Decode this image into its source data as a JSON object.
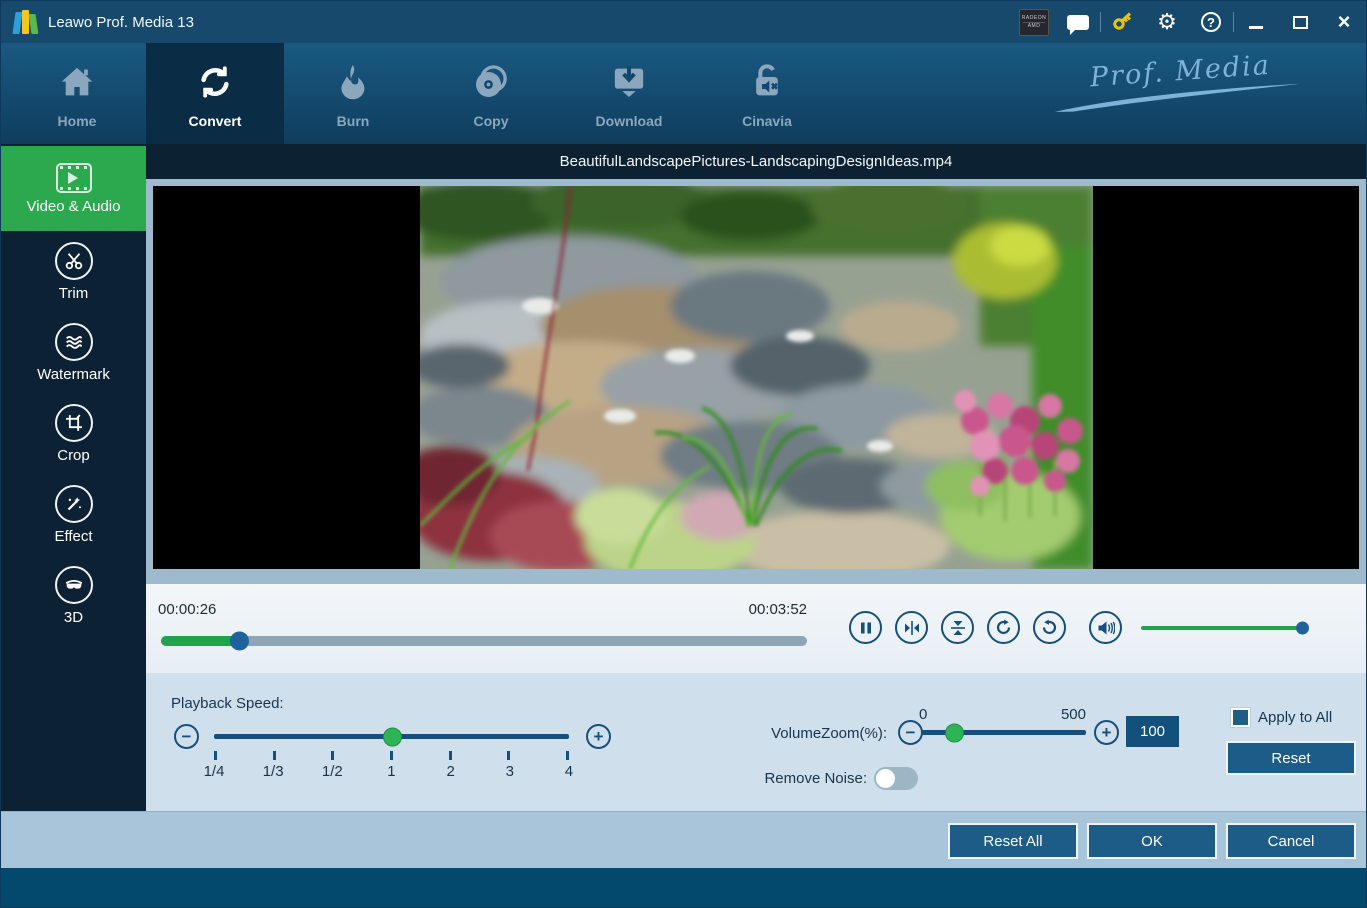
{
  "titlebar": {
    "title": "Leawo Prof. Media 13",
    "amd_badge_line1": "RADEON",
    "amd_badge_line2": "AMD",
    "gear_glyph": "⚙",
    "help_glyph": "?",
    "close_glyph": "×"
  },
  "nav": {
    "items": [
      {
        "label": "Home"
      },
      {
        "label": "Convert"
      },
      {
        "label": "Burn"
      },
      {
        "label": "Copy"
      },
      {
        "label": "Download"
      },
      {
        "label": "Cinavia"
      }
    ],
    "brand": "Prof. Media"
  },
  "sidebar": {
    "items": [
      {
        "label": "Video & Audio"
      },
      {
        "label": "Trim"
      },
      {
        "label": "Watermark"
      },
      {
        "label": "Crop"
      },
      {
        "label": "Effect"
      },
      {
        "label": "3D"
      }
    ]
  },
  "player": {
    "filename": "BeautifulLandscapePictures-LandscapingDesignIdeas.mp4",
    "current_time": "00:00:26",
    "total_time": "00:03:52",
    "progress_pct": 12,
    "volume_pct": 100
  },
  "settings": {
    "playback_speed": {
      "label": "Playback Speed:",
      "ticks": [
        "1/4",
        "1/3",
        "1/2",
        "1",
        "2",
        "3",
        "4"
      ],
      "value": "1",
      "thumb_pct": 50,
      "minus_glyph": "−",
      "plus_glyph": "+"
    },
    "volume_zoom": {
      "label": "VolumeZoom(%):",
      "min": "0",
      "max": "500",
      "value": "100",
      "thumb_pct": 20,
      "minus_glyph": "−",
      "plus_glyph": "+"
    },
    "remove_noise": {
      "label": "Remove Noise:",
      "enabled": false
    },
    "apply_to_all_label": "Apply to All",
    "reset_label": "Reset"
  },
  "footer": {
    "reset_all_label": "Reset All",
    "ok_label": "OK",
    "cancel_label": "Cancel"
  },
  "colors": {
    "accent_green": "#2ca94e",
    "progress_green": "#21a24b",
    "control_blue": "#174f7b",
    "button_blue": "#1d5c86",
    "titlebar": "#16496c",
    "sidebar_bg": "#0d2134",
    "panel_bg": "#cfe0ec"
  }
}
